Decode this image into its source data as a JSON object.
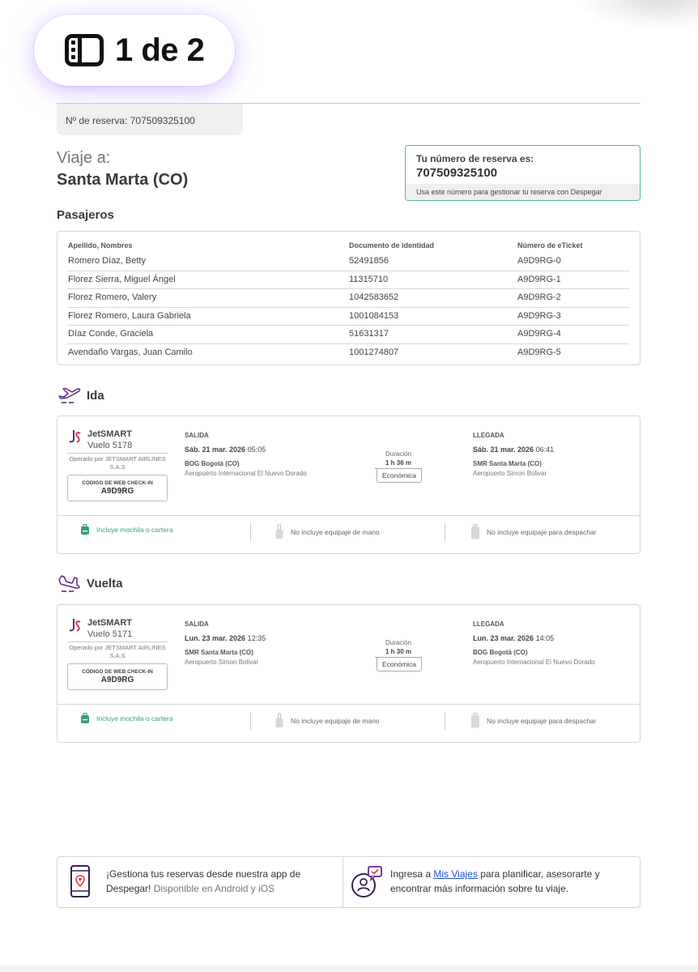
{
  "page_counter": {
    "text": "1 de 2"
  },
  "reservation": {
    "tab_label": "Nº de reserva: 707509325100",
    "box_label": "Tu número de reserva es:",
    "number": "707509325100",
    "box_footer": "Usa este número para gestionar tu reserva con Despegar"
  },
  "trip": {
    "label": "Viaje a:",
    "destination": "Santa Marta (CO)"
  },
  "passengers": {
    "title": "Pasajeros",
    "headers": [
      "Apellido, Nombres",
      "Documento de identidad",
      "Número de eTicket"
    ],
    "rows": [
      [
        "Romero Díaz, Betty",
        "52491856",
        "A9D9RG-0"
      ],
      [
        "Florez Sierra, Miguel Ángel",
        "11315710",
        "A9D9RG-1"
      ],
      [
        "Florez Romero, Valery",
        "1042583652",
        "A9D9RG-2"
      ],
      [
        "Florez Romero, Laura Gabriela",
        "1001084153",
        "A9D9RG-3"
      ],
      [
        "Díaz Conde, Graciela",
        "51631317",
        "A9D9RG-4"
      ],
      [
        "Avendaño Vargas, Juan Camilo",
        "1001274807",
        "A9D9RG-5"
      ]
    ]
  },
  "flights": [
    {
      "title": "Ida",
      "airline": "JetSMART",
      "flight_no": "Vuelo 5178",
      "operated_by": "Operado por JETSMART AIRLINES S.A.S",
      "checkin_label": "CÓDIGO DE WEB CHECK-IN",
      "checkin_code": "A9D9RG",
      "departure": {
        "label": "SALIDA",
        "date": "Sáb. 21 mar. 2026",
        "time": "05:05",
        "city": "BOG Bogotá (CO)",
        "airport": "Aeropuerto Internacional El Nuevo Dorado"
      },
      "duration_label": "Duración",
      "duration": "1 h 36 m",
      "cabin": "Económica",
      "arrival": {
        "label": "LLEGADA",
        "date": "Sáb. 21 mar. 2026",
        "time": "06:41",
        "city": "SMR Santa Marta (CO)",
        "airport": "Aeropuerto Simon Bolivar"
      },
      "baggage": [
        "Incluye mochila o cartera",
        "No incluye equipaje de mano",
        "No incluye equipaje para despachar"
      ]
    },
    {
      "title": "Vuelta",
      "airline": "JetSMART",
      "flight_no": "Vuelo 5171",
      "operated_by": "Operado por JETSMART AIRLINES S.A.S",
      "checkin_label": "CÓDIGO DE WEB CHECK-IN",
      "checkin_code": "A9D9RG",
      "departure": {
        "label": "SALIDA",
        "date": "Lun. 23 mar. 2026",
        "time": "12:35",
        "city": "SMR Santa Marta (CO)",
        "airport": "Aeropuerto Simon Bolivar"
      },
      "duration_label": "Duración",
      "duration": "1 h 30 m",
      "cabin": "Económica",
      "arrival": {
        "label": "LLEGADA",
        "date": "Lun. 23 mar. 2026",
        "time": "14:05",
        "city": "BOG Bogotá (CO)",
        "airport": "Aeropuerto Internacional El Nuevo Dorado"
      },
      "baggage": [
        "Incluye mochila o cartera",
        "No incluye equipaje de mano",
        "No incluye equipaje para despachar"
      ]
    }
  ],
  "footer": {
    "app_text": "¡Gestiona tus reservas desde nuestra app de Despegar!",
    "app_text_gray": "Disponible en Android y iOS",
    "trips_prefix": "Ingresa a",
    "trips_link": "Mis Viajes",
    "trips_suffix": "para planificar, asesorarte y encontrar más información sobre tu viaje."
  },
  "colors": {
    "accent_green": "#3a9c82",
    "brand_purple": "#5b2a86",
    "link_blue": "#1a4fd6"
  },
  "icons": [
    "pages-icon",
    "plane-takeoff-icon",
    "plane-landing-icon",
    "jetsmart-logo-icon",
    "backpack-icon",
    "carry-on-icon",
    "checked-bag-icon",
    "phone-location-icon",
    "chat-user-icon"
  ]
}
